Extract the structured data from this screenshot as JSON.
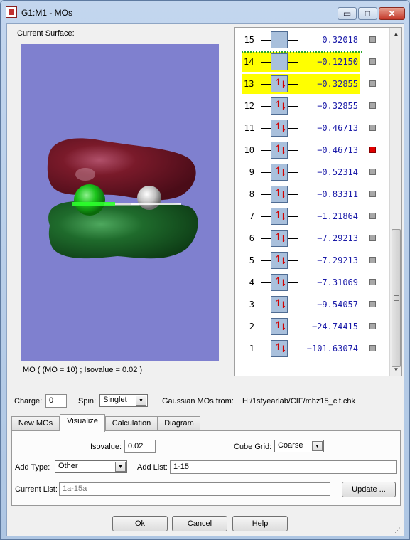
{
  "window": {
    "title": "G1:M1 - MOs",
    "minimize": "▭",
    "maximize": "□",
    "close": "✕"
  },
  "surface": {
    "label": "Current Surface:",
    "caption": "MO ( (MO = 10) ; Isovalue = 0.02 )",
    "background": "#7f80cf"
  },
  "orbitals": [
    {
      "num": "15",
      "energy": "0.32018",
      "occupied": false,
      "checked": false,
      "highlight": "none"
    },
    {
      "num": "14",
      "energy": "−0.12150",
      "occupied": false,
      "checked": false,
      "highlight": "yellow"
    },
    {
      "num": "13",
      "energy": "−0.32855",
      "occupied": true,
      "checked": false,
      "highlight": "yellow"
    },
    {
      "num": "12",
      "energy": "−0.32855",
      "occupied": true,
      "checked": false,
      "highlight": "none"
    },
    {
      "num": "11",
      "energy": "−0.46713",
      "occupied": true,
      "checked": false,
      "highlight": "none"
    },
    {
      "num": "10",
      "energy": "−0.46713",
      "occupied": true,
      "checked": true,
      "highlight": "none"
    },
    {
      "num": "9",
      "energy": "−0.52314",
      "occupied": true,
      "checked": false,
      "highlight": "none"
    },
    {
      "num": "8",
      "energy": "−0.83311",
      "occupied": true,
      "checked": false,
      "highlight": "none"
    },
    {
      "num": "7",
      "energy": "−1.21864",
      "occupied": true,
      "checked": false,
      "highlight": "none"
    },
    {
      "num": "6",
      "energy": "−7.29213",
      "occupied": true,
      "checked": false,
      "highlight": "none"
    },
    {
      "num": "5",
      "energy": "−7.29213",
      "occupied": true,
      "checked": false,
      "highlight": "none"
    },
    {
      "num": "4",
      "energy": "−7.31069",
      "occupied": true,
      "checked": false,
      "highlight": "none"
    },
    {
      "num": "3",
      "energy": "−9.54057",
      "occupied": true,
      "checked": false,
      "highlight": "none"
    },
    {
      "num": "2",
      "energy": "−24.74415",
      "occupied": true,
      "checked": false,
      "highlight": "none"
    },
    {
      "num": "1",
      "energy": "−101.63074",
      "occupied": true,
      "checked": false,
      "highlight": "none"
    }
  ],
  "controls": {
    "charge_label": "Charge:",
    "charge_value": "0",
    "spin_label": "Spin:",
    "spin_value": "Singlet",
    "source_label": "Gaussian MOs from:",
    "source_path": "H:/1styearlab/CIF/mhz15_clf.chk"
  },
  "tabs": [
    "New MOs",
    "Visualize",
    "Calculation",
    "Diagram"
  ],
  "active_tab": "Visualize",
  "visualize": {
    "isovalue_label": "Isovalue:",
    "isovalue_value": "0.02",
    "cube_grid_label": "Cube Grid:",
    "cube_grid_value": "Coarse",
    "add_type_label": "Add Type:",
    "add_type_value": "Other",
    "add_list_label": "Add List:",
    "add_list_value": "1-15",
    "current_list_label": "Current List:",
    "current_list_value": "1a-15a",
    "update_button": "Update ..."
  },
  "buttons": {
    "ok": "Ok",
    "cancel": "Cancel",
    "help": "Help"
  },
  "colors": {
    "homo_highlight": "#ffff00",
    "energy_text": "#1a1aa8",
    "electron_arrow": "#d10000",
    "lobe_positive": "#7a1a2a",
    "lobe_negative": "#1f6b2c",
    "checked": "#e00000"
  }
}
